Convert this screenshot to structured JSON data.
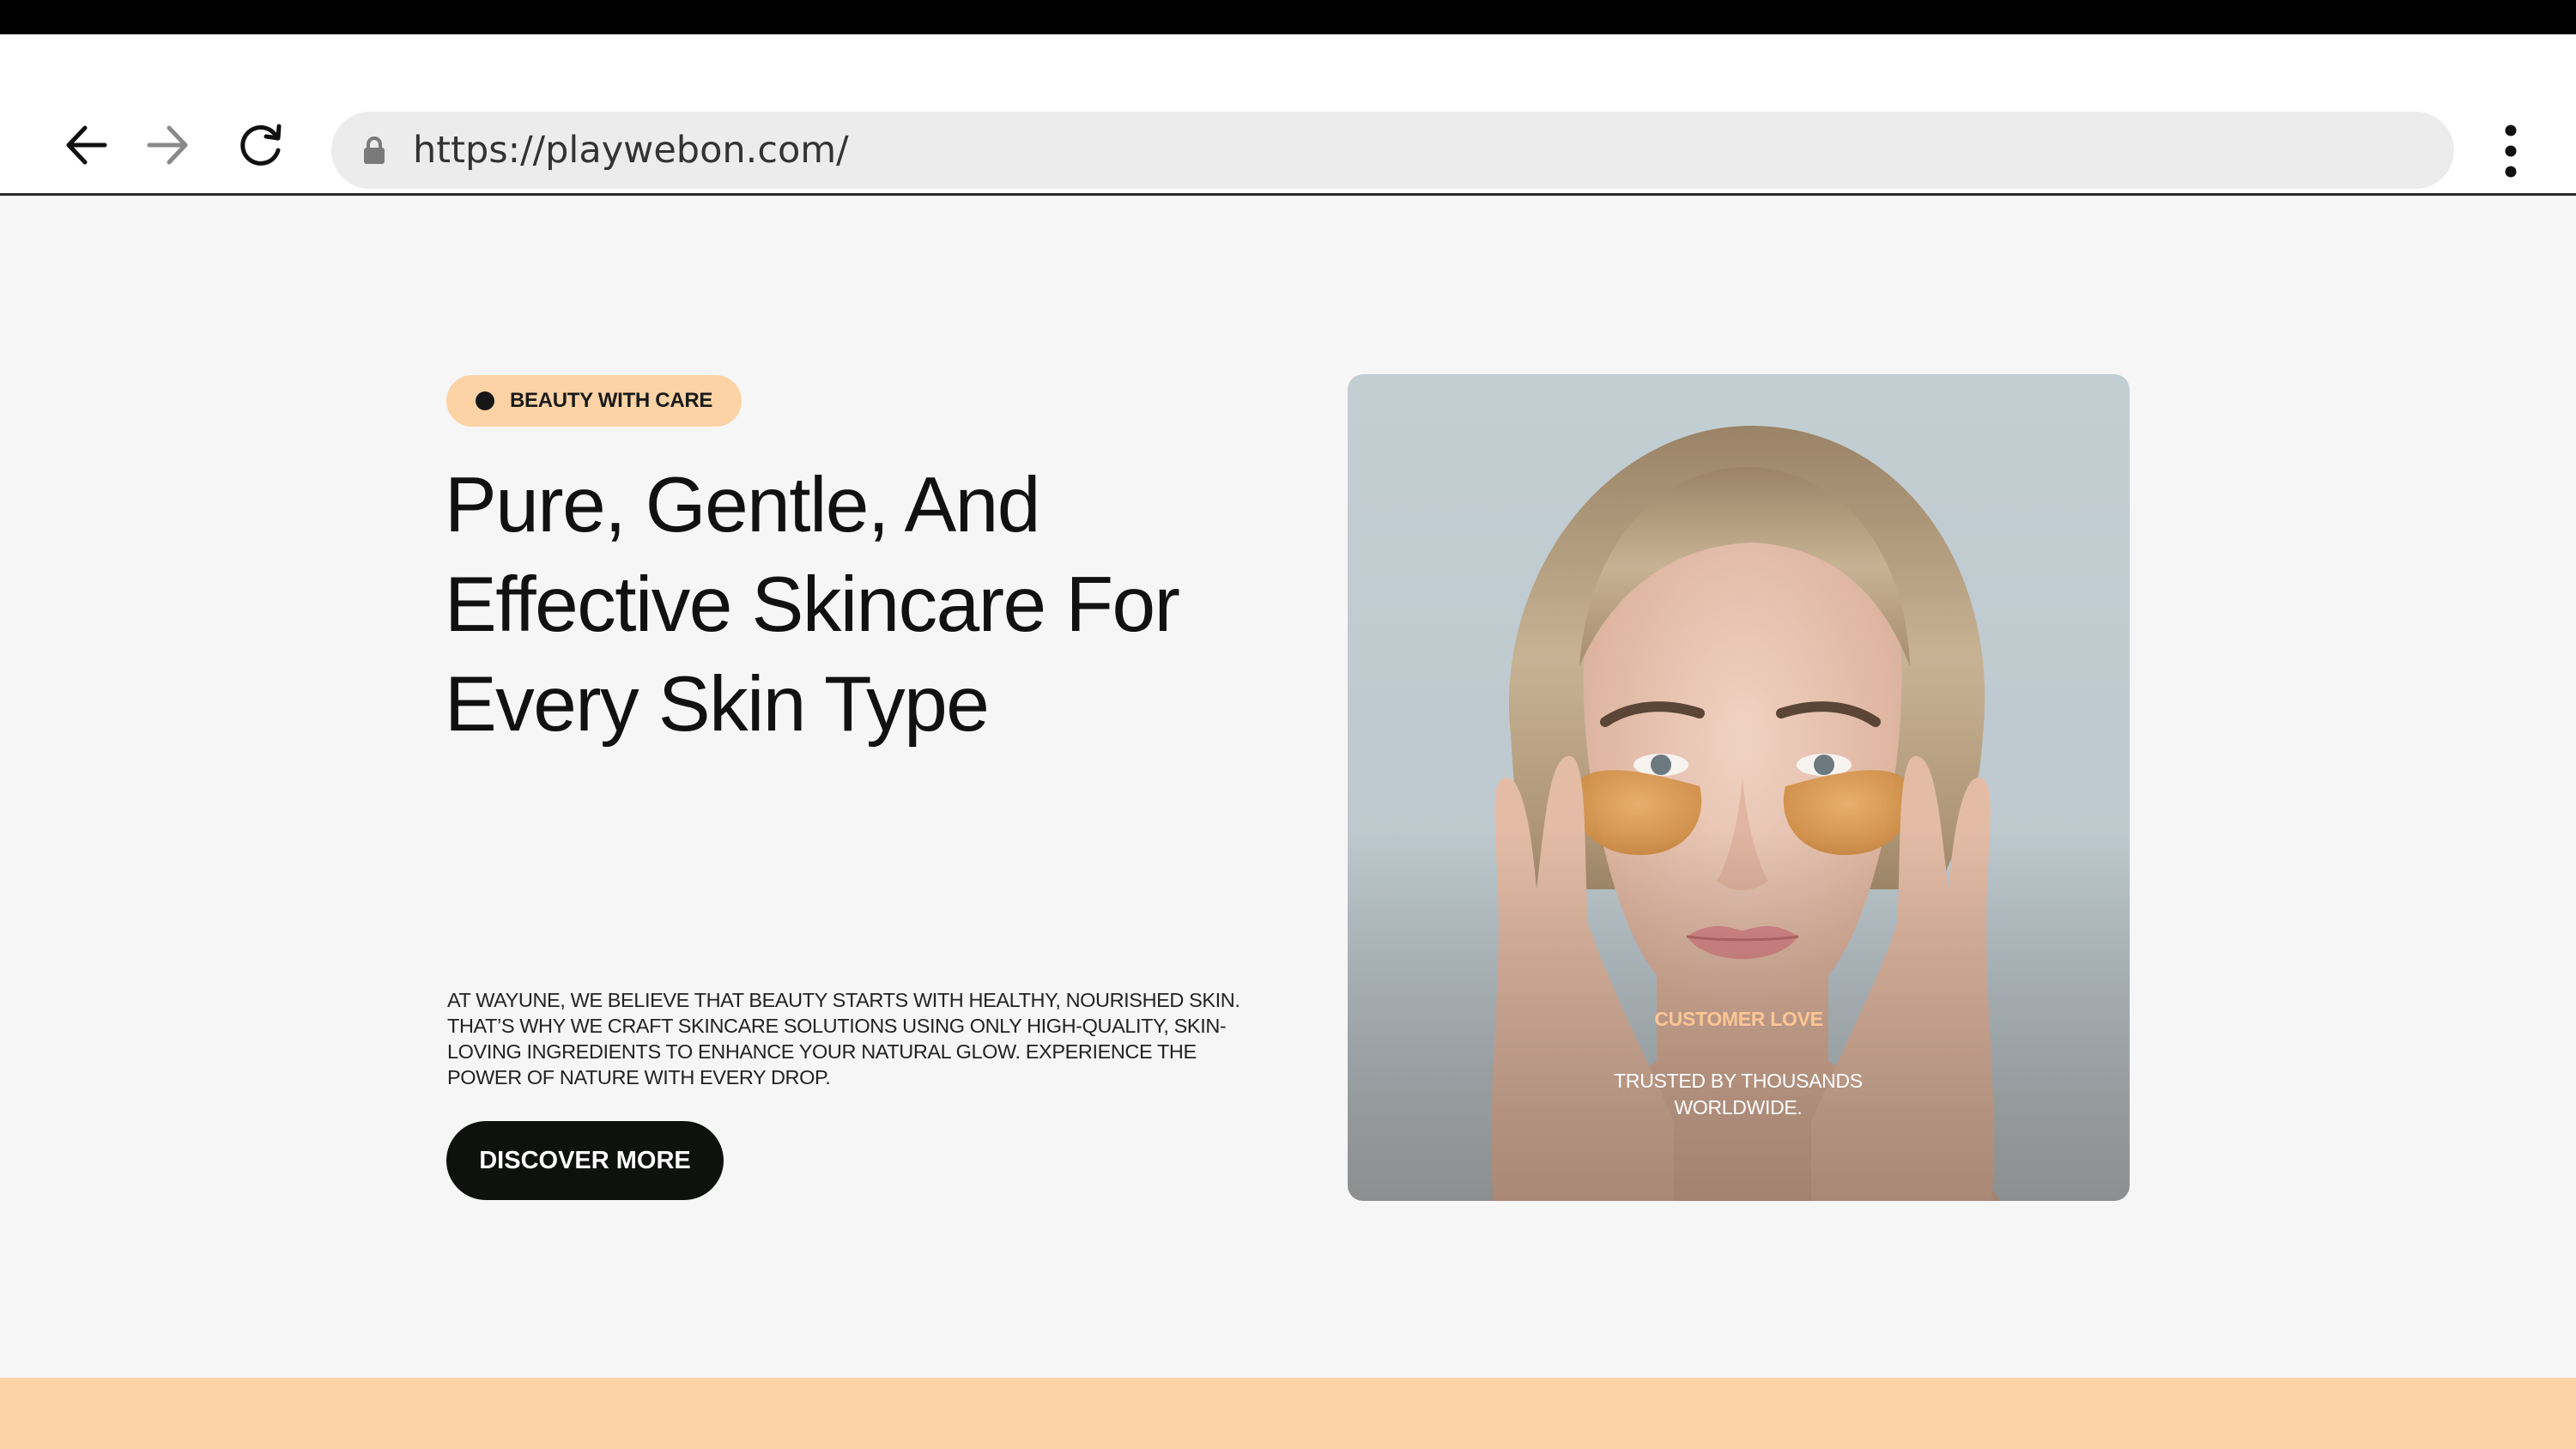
{
  "browser": {
    "url": "https://playwebon.com/",
    "icons": {
      "back": "arrow-left-icon",
      "forward": "arrow-right-icon",
      "reload": "reload-icon",
      "lock": "lock-icon",
      "menu": "more-vertical-icon"
    }
  },
  "hero": {
    "badge_label": "BEAUTY WITH CARE",
    "title_lines": [
      "Pure, Gentle, And",
      "Effective Skincare For",
      "Every Skin Type"
    ],
    "description_lines": [
      "AT WAYUNE, WE BELIEVE THAT BEAUTY STARTS WITH HEALTHY, NOURISHED SKIN.",
      "THAT’S WHY WE CRAFT SKINCARE SOLUTIONS USING ONLY HIGH-QUALITY, SKIN-",
      "LOVING INGREDIENTS TO ENHANCE YOUR NATURAL GLOW. EXPERIENCE THE",
      "POWER OF NATURE WITH EVERY DROP."
    ],
    "cta_label": "DISCOVER MORE",
    "image": {
      "kicker": "CUSTOMER LOVE",
      "caption_lines": [
        "TRUSTED BY THOUSANDS",
        "WORLDWIDE."
      ]
    }
  },
  "colors": {
    "accent_peach": "#fdd3a5",
    "dark": "#0f110f",
    "kicker_text": "#fbc795",
    "page_background": "#f6f6f6"
  }
}
